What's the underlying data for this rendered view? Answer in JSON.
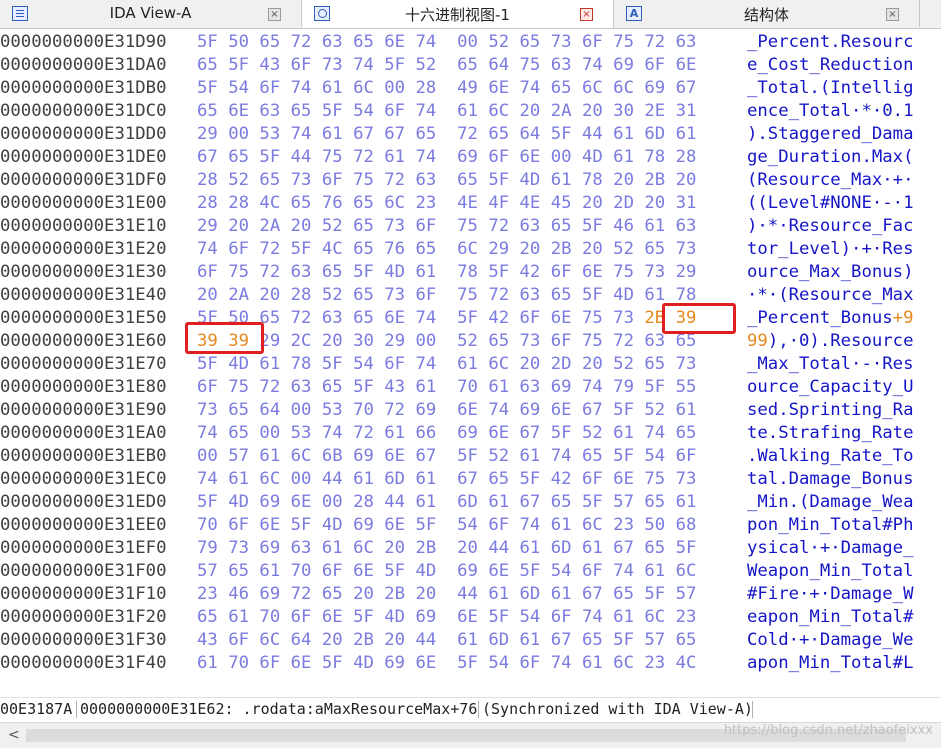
{
  "tabs": [
    {
      "label": "IDA View-A",
      "icon": "list-icon",
      "active": false
    },
    {
      "label": "十六进制视图-1",
      "icon": "hex-view-icon",
      "active": true
    },
    {
      "label": "结构体",
      "icon": "struct-icon",
      "active": false
    }
  ],
  "close_glyph": "×",
  "rows": [
    {
      "addr": "0000000000E31D90",
      "hex": "5F 50 65 72 63 65 6E 74  00 52 65 73 6F 75 72 63",
      "ascii": "_Percent.Resourc"
    },
    {
      "addr": "0000000000E31DA0",
      "hex": "65 5F 43 6F 73 74 5F 52  65 64 75 63 74 69 6F 6E",
      "ascii": "e_Cost_Reduction"
    },
    {
      "addr": "0000000000E31DB0",
      "hex": "5F 54 6F 74 61 6C 00 28  49 6E 74 65 6C 6C 69 67",
      "ascii": "_Total.(Intellig"
    },
    {
      "addr": "0000000000E31DC0",
      "hex": "65 6E 63 65 5F 54 6F 74  61 6C 20 2A 20 30 2E 31",
      "ascii": "ence_Total·*·0.1"
    },
    {
      "addr": "0000000000E31DD0",
      "hex": "29 00 53 74 61 67 67 65  72 65 64 5F 44 61 6D 61",
      "ascii": ").Staggered_Dama"
    },
    {
      "addr": "0000000000E31DE0",
      "hex": "67 65 5F 44 75 72 61 74  69 6F 6E 00 4D 61 78 28",
      "ascii": "ge_Duration.Max("
    },
    {
      "addr": "0000000000E31DF0",
      "hex": "28 52 65 73 6F 75 72 63  65 5F 4D 61 78 20 2B 20",
      "ascii": "(Resource_Max·+·"
    },
    {
      "addr": "0000000000E31E00",
      "hex": "28 28 4C 65 76 65 6C 23  4E 4F 4E 45 20 2D 20 31",
      "ascii": "((Level#NONE·-·1"
    },
    {
      "addr": "0000000000E31E10",
      "hex": "29 20 2A 20 52 65 73 6F  75 72 63 65 5F 46 61 63",
      "ascii": ")·*·Resource_Fac"
    },
    {
      "addr": "0000000000E31E20",
      "hex": "74 6F 72 5F 4C 65 76 65  6C 29 20 2B 20 52 65 73",
      "ascii": "tor_Level)·+·Res"
    },
    {
      "addr": "0000000000E31E30",
      "hex": "6F 75 72 63 65 5F 4D 61  78 5F 42 6F 6E 75 73 29",
      "ascii": "ource_Max_Bonus)"
    },
    {
      "addr": "0000000000E31E40",
      "hex": "20 2A 20 28 52 65 73 6F  75 72 63 65 5F 4D 61 78",
      "ascii": "·*·(Resource_Max"
    },
    {
      "addr": "0000000000E31E50",
      "hex_a": "5F 50 65 72 63 65 6E 74  5F 42 6F 6E 75 73 ",
      "hex_b": "2B 39",
      "ascii_a": "_Percent_Bonus",
      "ascii_b": "+9"
    },
    {
      "addr": "0000000000E31E60",
      "hex_b": "39 39",
      "hex_a": " 29 2C 20 30 29 00  52 65 73 6F 75 72 63 65",
      "ascii_b": "99",
      "ascii_a": "),·0).Resource"
    },
    {
      "addr": "0000000000E31E70",
      "hex": "5F 4D 61 78 5F 54 6F 74  61 6C 20 2D 20 52 65 73",
      "ascii": "_Max_Total·-·Res"
    },
    {
      "addr": "0000000000E31E80",
      "hex": "6F 75 72 63 65 5F 43 61  70 61 63 69 74 79 5F 55",
      "ascii": "ource_Capacity_U"
    },
    {
      "addr": "0000000000E31E90",
      "hex": "73 65 64 00 53 70 72 69  6E 74 69 6E 67 5F 52 61",
      "ascii": "sed.Sprinting_Ra"
    },
    {
      "addr": "0000000000E31EA0",
      "hex": "74 65 00 53 74 72 61 66  69 6E 67 5F 52 61 74 65",
      "ascii": "te.Strafing_Rate"
    },
    {
      "addr": "0000000000E31EB0",
      "hex": "00 57 61 6C 6B 69 6E 67  5F 52 61 74 65 5F 54 6F",
      "ascii": ".Walking_Rate_To"
    },
    {
      "addr": "0000000000E31EC0",
      "hex": "74 61 6C 00 44 61 6D 61  67 65 5F 42 6F 6E 75 73",
      "ascii": "tal.Damage_Bonus"
    },
    {
      "addr": "0000000000E31ED0",
      "hex": "5F 4D 69 6E 00 28 44 61  6D 61 67 65 5F 57 65 61",
      "ascii": "_Min.(Damage_Wea"
    },
    {
      "addr": "0000000000E31EE0",
      "hex": "70 6F 6E 5F 4D 69 6E 5F  54 6F 74 61 6C 23 50 68",
      "ascii": "pon_Min_Total#Ph"
    },
    {
      "addr": "0000000000E31EF0",
      "hex": "79 73 69 63 61 6C 20 2B  20 44 61 6D 61 67 65 5F",
      "ascii": "ysical·+·Damage_"
    },
    {
      "addr": "0000000000E31F00",
      "hex": "57 65 61 70 6F 6E 5F 4D  69 6E 5F 54 6F 74 61 6C",
      "ascii": "Weapon_Min_Total"
    },
    {
      "addr": "0000000000E31F10",
      "hex": "23 46 69 72 65 20 2B 20  44 61 6D 61 67 65 5F 57",
      "ascii": "#Fire·+·Damage_W"
    },
    {
      "addr": "0000000000E31F20",
      "hex": "65 61 70 6F 6E 5F 4D 69  6E 5F 54 6F 74 61 6C 23",
      "ascii": "eapon_Min_Total#"
    },
    {
      "addr": "0000000000E31F30",
      "hex": "43 6F 6C 64 20 2B 20 44  61 6D 61 67 65 5F 57 65",
      "ascii": "Cold·+·Damage_We"
    },
    {
      "addr": "0000000000E31F40",
      "hex": "61 70 6F 6E 5F 4D 69 6E  5F 54 6F 74 61 6C 23 4C",
      "ascii": "apon_Min_Total#L"
    }
  ],
  "status": {
    "offset": "00E3187A",
    "location": "0000000000E31E62: .rodata:aMaxResourceMax+76",
    "sync": "(Synchronized with IDA View-A)"
  },
  "watermark": "https://blog.csdn.net/zhaofeixxx",
  "colors": {
    "address": "#404040",
    "hex": "#7b7be0",
    "ascii": "#1515c8",
    "highlight": "#e68a1f",
    "annotation_box": "#e02020"
  }
}
